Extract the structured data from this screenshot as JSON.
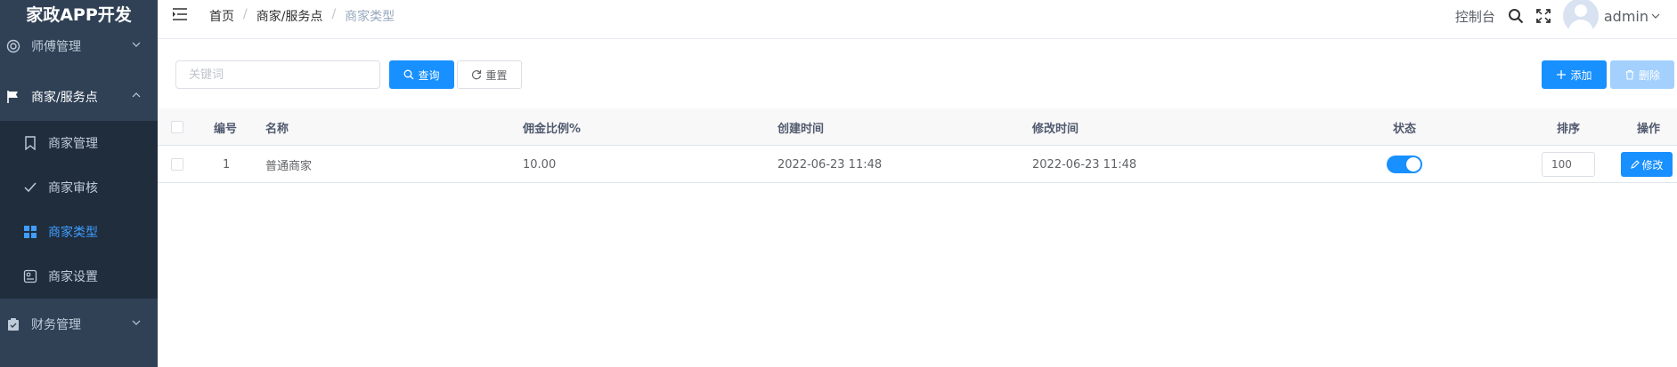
{
  "app": {
    "title": "家政APP开发"
  },
  "sidebar": {
    "items": [
      {
        "label": "师傅管理",
        "icon": "lifebuoy-icon"
      },
      {
        "label": "商家/服务点",
        "icon": "flag-icon"
      },
      {
        "label": "财务管理",
        "icon": "clipboard-icon"
      }
    ],
    "sub_items": [
      {
        "label": "商家管理",
        "icon": "bookmark-icon"
      },
      {
        "label": "商家审核",
        "icon": "check-icon"
      },
      {
        "label": "商家类型",
        "icon": "grid-icon",
        "active": true
      },
      {
        "label": "商家设置",
        "icon": "settings-card-icon"
      }
    ]
  },
  "breadcrumb": {
    "home": "首页",
    "parent": "商家/服务点",
    "current": "商家类型",
    "separator": "/"
  },
  "navbar": {
    "console": "控制台",
    "user": "admin"
  },
  "search": {
    "placeholder": "关键词",
    "query_label": "查询",
    "reset_label": "重置"
  },
  "toolbar": {
    "add_label": "添加",
    "delete_label": "删除"
  },
  "table": {
    "headers": {
      "id": "编号",
      "name": "名称",
      "commission": "佣金比例%",
      "created": "创建时间",
      "modified": "修改时间",
      "status": "状态",
      "sort": "排序",
      "action": "操作"
    },
    "rows": [
      {
        "id": "1",
        "name": "普通商家",
        "commission": "10.00",
        "created": "2022-06-23 11:48",
        "modified": "2022-06-23 11:48",
        "status": true,
        "sort": "100",
        "edit_label": "修改"
      }
    ]
  },
  "colors": {
    "sidebar_bg": "#304156",
    "submenu_bg": "#1f2d3d",
    "primary": "#1890ff",
    "active_text": "#409eff"
  }
}
